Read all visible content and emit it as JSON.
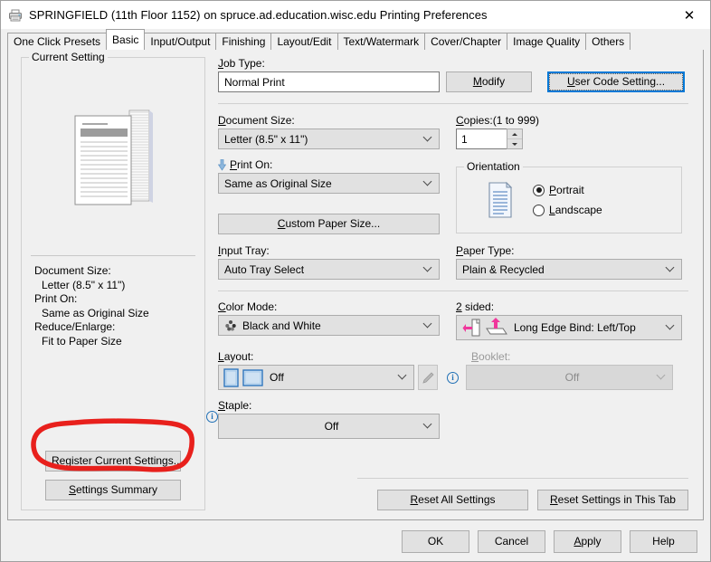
{
  "titlebar": {
    "icon": "printer-icon",
    "title": "SPRINGFIELD (11th Floor 1152) on spruce.ad.education.wisc.edu Printing Preferences",
    "close": "✕"
  },
  "tabs": [
    {
      "label": "One Click Presets",
      "active": false
    },
    {
      "label": "Basic",
      "active": true
    },
    {
      "label": "Input/Output",
      "active": false
    },
    {
      "label": "Finishing",
      "active": false
    },
    {
      "label": "Layout/Edit",
      "active": false
    },
    {
      "label": "Text/Watermark",
      "active": false
    },
    {
      "label": "Cover/Chapter",
      "active": false
    },
    {
      "label": "Image Quality",
      "active": false
    },
    {
      "label": "Others",
      "active": false
    }
  ],
  "current_setting": {
    "legend": "Current Setting",
    "preview_icon": "document-stack-preview",
    "summary": [
      {
        "label": "Document Size:",
        "value": "Letter (8.5\" x 11\")"
      },
      {
        "label": "Print On:",
        "value": "Same as Original Size"
      },
      {
        "label": "Reduce/Enlarge:",
        "value": "Fit to Paper Size"
      }
    ],
    "register_button": {
      "prefix": "R",
      "rest": "egister Current Settings..."
    },
    "summary_button": {
      "prefix": "S",
      "rest": "ettings Summary"
    }
  },
  "job_type": {
    "label_prefix": "J",
    "label_rest": "ob Type:",
    "value": "Normal Print",
    "modify_button": {
      "prefix": "M",
      "rest": "odify"
    },
    "user_code_button": {
      "prefix": "U",
      "rest": "ser Code Setting..."
    }
  },
  "document_size": {
    "label_prefix": "D",
    "label_rest": "ocument Size:",
    "value": "Letter (8.5\" x 11\")"
  },
  "copies": {
    "label_prefix": "C",
    "label_rest": "opies:(1 to 999)",
    "value": "1"
  },
  "print_on": {
    "label_prefix": "P",
    "label_rest": "rint On:",
    "value": "Same as Original Size",
    "icon": "down-arrow-icon"
  },
  "custom_paper_size_button": {
    "prefix": "C",
    "rest": "ustom Paper Size..."
  },
  "orientation": {
    "legend": "Orientation",
    "icon": "page-portrait-icon",
    "options": [
      {
        "prefix": "P",
        "rest": "ortrait",
        "selected": true
      },
      {
        "prefix": "L",
        "rest": "andscape",
        "selected": false
      }
    ]
  },
  "input_tray": {
    "label_prefix": "I",
    "label_rest": "nput Tray:",
    "value": "Auto Tray Select"
  },
  "paper_type": {
    "label_prefix": "P",
    "label_rest": "aper Type:",
    "value": "Plain & Recycled"
  },
  "color_mode": {
    "label_prefix": "C",
    "label_rest": "olor Mode:",
    "value": "Black and White",
    "icon": "color-dots-icon"
  },
  "two_sided": {
    "label_prefix": "2",
    "label_rest": " sided:",
    "value": "Long Edge Bind: Left/Top",
    "icons": [
      "duplex-left-icon",
      "duplex-top-icon"
    ]
  },
  "layout": {
    "label_prefix": "L",
    "label_rest": "ayout:",
    "value": "Off",
    "icons": [
      "page-portrait-blue-icon",
      "page-landscape-blue-icon"
    ],
    "edit_icon": "pencil-icon"
  },
  "booklet": {
    "label_prefix": "B",
    "label_rest": "ooklet:",
    "value": "Off",
    "disabled": true,
    "info_icon": "info-icon"
  },
  "staple": {
    "label_prefix": "S",
    "label_rest": "taple:",
    "value": "Off",
    "info_icon": "info-icon"
  },
  "reset_buttons": [
    {
      "prefix": "R",
      "rest": "eset All Settings"
    },
    {
      "prefix": "R",
      "rest": "eset Settings in This Tab"
    }
  ],
  "dialog_buttons": [
    {
      "label": "OK",
      "prefix": "",
      "rest": "OK"
    },
    {
      "label": "Cancel",
      "prefix": "",
      "rest": "Cancel"
    },
    {
      "label": "Apply",
      "prefix": "A",
      "rest": "pply"
    },
    {
      "label": "Help",
      "prefix": "",
      "rest": "Help"
    }
  ],
  "annotation": {
    "shape": "hand-drawn-red-circle",
    "color": "#e8201c",
    "target": "Register Current Settings..."
  }
}
